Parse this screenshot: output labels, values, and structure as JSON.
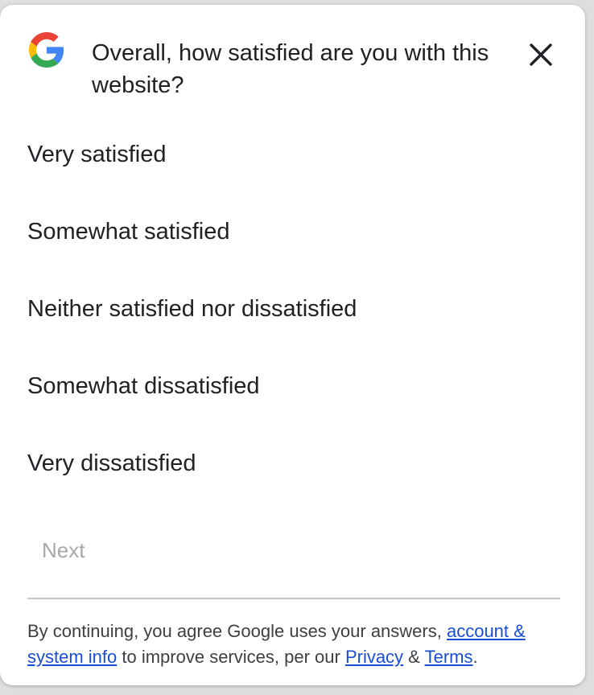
{
  "dialog": {
    "question": "Overall, how satisfied are you with this website?",
    "logo_icon": "google-g-icon",
    "close_icon": "close-icon"
  },
  "options": [
    {
      "label": "Very satisfied"
    },
    {
      "label": "Somewhat satisfied"
    },
    {
      "label": "Neither satisfied nor dissatisfied"
    },
    {
      "label": "Somewhat dissatisfied"
    },
    {
      "label": "Very dissatisfied"
    }
  ],
  "next_label": "Next",
  "footer": {
    "text_1": "By continuing, you agree Google uses your answers, ",
    "link_account": "account & system info",
    "text_2": " to improve services, per our ",
    "link_privacy": "Privacy",
    "text_3": " & ",
    "link_terms": "Terms",
    "text_4": "."
  },
  "colors": {
    "link": "#1a4dd6",
    "text": "#202124",
    "disabled": "#a8a8a8",
    "google_blue": "#4285F4",
    "google_red": "#EA4335",
    "google_yellow": "#FBBC05",
    "google_green": "#34A853"
  }
}
